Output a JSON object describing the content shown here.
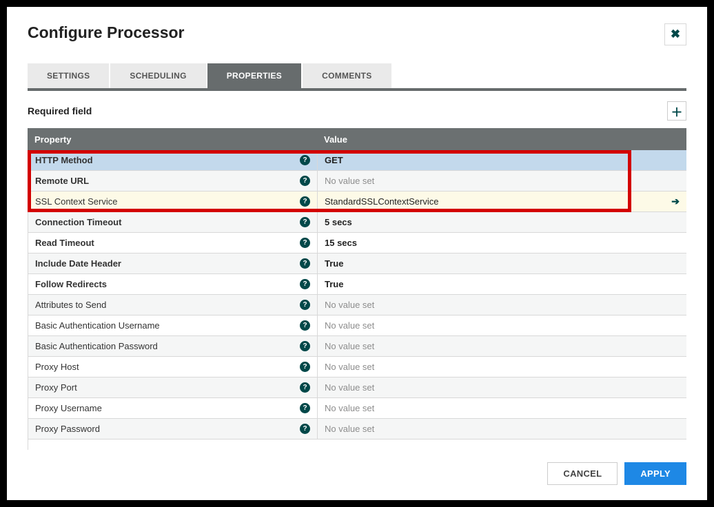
{
  "dialog": {
    "title": "Configure Processor",
    "hint": "Required field"
  },
  "tabs": [
    {
      "id": "settings",
      "label": "SETTINGS",
      "active": false
    },
    {
      "id": "scheduling",
      "label": "SCHEDULING",
      "active": false
    },
    {
      "id": "properties",
      "label": "PROPERTIES",
      "active": true
    },
    {
      "id": "comments",
      "label": "COMMENTS",
      "active": false
    }
  ],
  "columns": {
    "property": "Property",
    "value": "Value"
  },
  "empty_value_label": "No value set",
  "properties": [
    {
      "name": "HTTP Method",
      "value": "GET",
      "required": true,
      "highlight": "blue",
      "nav": false
    },
    {
      "name": "Remote URL",
      "value": null,
      "required": true,
      "highlight": "none",
      "nav": false
    },
    {
      "name": "SSL Context Service",
      "value": "StandardSSLContextService",
      "required": false,
      "highlight": "yellow",
      "nav": true
    },
    {
      "name": "Connection Timeout",
      "value": "5 secs",
      "required": true,
      "highlight": "none",
      "nav": false
    },
    {
      "name": "Read Timeout",
      "value": "15 secs",
      "required": true,
      "highlight": "none",
      "nav": false
    },
    {
      "name": "Include Date Header",
      "value": "True",
      "required": true,
      "highlight": "none",
      "nav": false
    },
    {
      "name": "Follow Redirects",
      "value": "True",
      "required": true,
      "highlight": "none",
      "nav": false
    },
    {
      "name": "Attributes to Send",
      "value": null,
      "required": false,
      "highlight": "none",
      "nav": false
    },
    {
      "name": "Basic Authentication Username",
      "value": null,
      "required": false,
      "highlight": "none",
      "nav": false
    },
    {
      "name": "Basic Authentication Password",
      "value": null,
      "required": false,
      "highlight": "none",
      "nav": false
    },
    {
      "name": "Proxy Host",
      "value": null,
      "required": false,
      "highlight": "none",
      "nav": false
    },
    {
      "name": "Proxy Port",
      "value": null,
      "required": false,
      "highlight": "none",
      "nav": false
    },
    {
      "name": "Proxy Username",
      "value": null,
      "required": false,
      "highlight": "none",
      "nav": false
    },
    {
      "name": "Proxy Password",
      "value": null,
      "required": false,
      "highlight": "none",
      "nav": false
    }
  ],
  "buttons": {
    "cancel": "CANCEL",
    "apply": "APPLY"
  }
}
